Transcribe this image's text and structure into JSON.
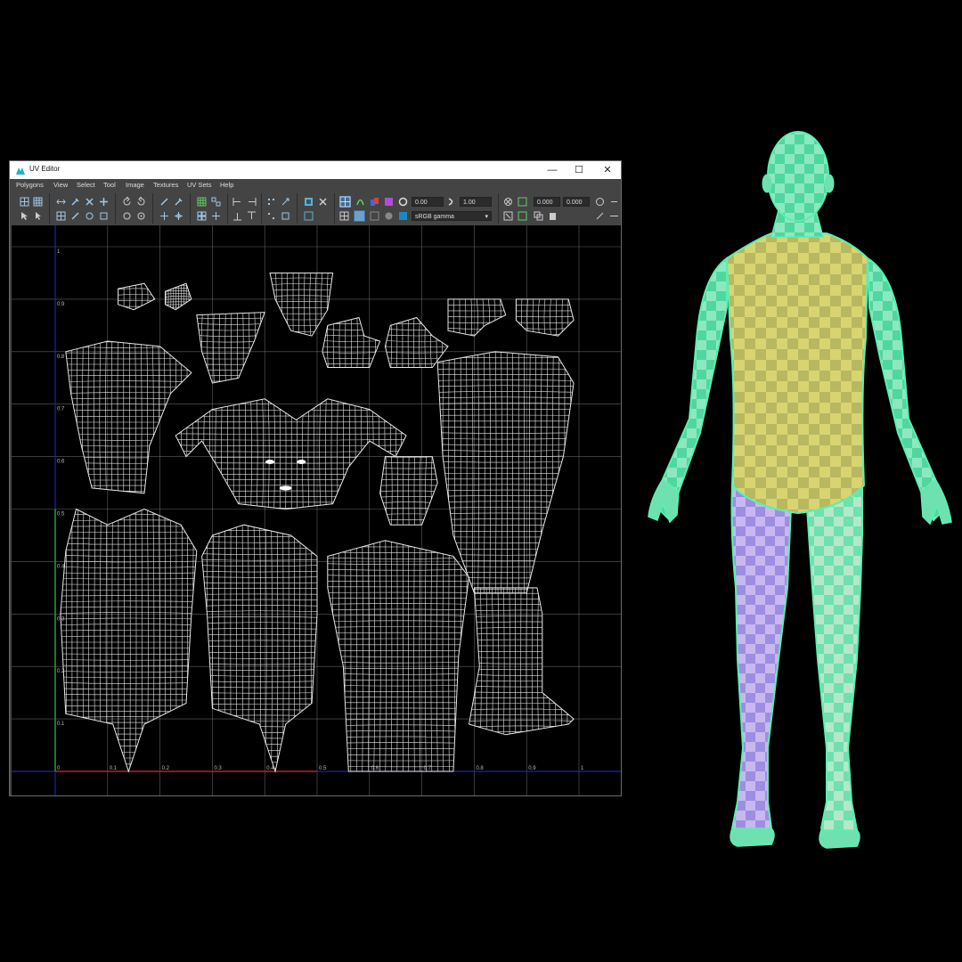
{
  "window": {
    "title": "UV Editor",
    "controls": {
      "minimize": "—",
      "maximize": "☐",
      "close": "✕"
    }
  },
  "menu": [
    "Polygons",
    "View",
    "Select",
    "Tool",
    "Image",
    "Textures",
    "UV Sets",
    "Help"
  ],
  "toolbar": {
    "value_a": "0.00",
    "value_b": "1.00",
    "value_c": "0.000",
    "value_d": "0.000",
    "color_space": "sRGB gamma"
  },
  "grid": {
    "v_labels": [
      "1",
      "0.9",
      "0.8",
      "0.7",
      "0.6",
      "0.5",
      "0.4",
      "0.3",
      "0.2",
      "0.1"
    ],
    "u_labels": [
      "0",
      "0.1",
      "0.2",
      "0.3",
      "0.4",
      "0.5",
      "0.6",
      "0.7",
      "0.8",
      "0.9",
      "1"
    ]
  },
  "uv_shells": [
    "eye-left",
    "eye-right",
    "foot-top-left",
    "foot-top-right",
    "hand-left",
    "hand-right",
    "hand-side-left",
    "hand-side-right",
    "upper-arm",
    "head-face",
    "soles",
    "leg-front",
    "torso-back",
    "torso-front",
    "leg-back",
    "lower-leg"
  ],
  "colors": {
    "accent": "#1fb3c7",
    "selected_tool": "#3e6d96",
    "grid_line": "#8a8a8a",
    "u_axis": "#c21b1b",
    "v_axis": "#1f9b1f",
    "base_axis": "#2222aa",
    "wire": "#e8e8e8",
    "mesh_green": "#5af0b0",
    "mesh_yellow": "#e8d76a",
    "mesh_purple": "#9d8ee3"
  }
}
